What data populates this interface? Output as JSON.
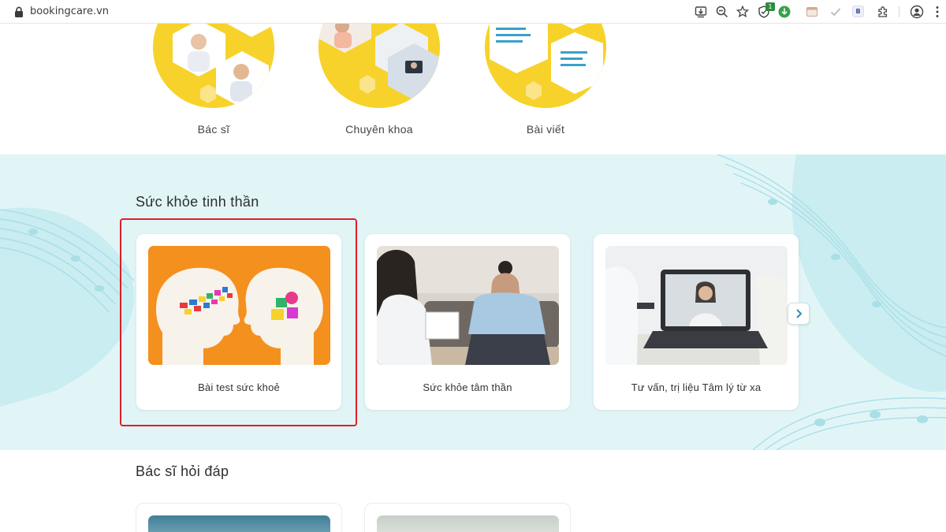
{
  "browser": {
    "url": "bookingcare.vn",
    "extension_badge": "1",
    "extension_letter": "B"
  },
  "categories": [
    {
      "label": "Bác sĩ"
    },
    {
      "label": "Chuyên khoa"
    },
    {
      "label": "Bài viết"
    }
  ],
  "mental_health": {
    "title": "Sức khỏe tinh thần",
    "cards": [
      {
        "label": "Bài test sức khoẻ"
      },
      {
        "label": "Sức khỏe tâm thần"
      },
      {
        "label": "Tư vấn, trị liệu Tâm lý từ xa"
      }
    ]
  },
  "doctor_qa": {
    "title": "Bác sĩ hỏi đáp"
  },
  "colors": {
    "accent_yellow": "#f7d22a",
    "band_background": "#e1f5f7",
    "highlight_red": "#e01e25",
    "card_orange": "#f4901e"
  }
}
